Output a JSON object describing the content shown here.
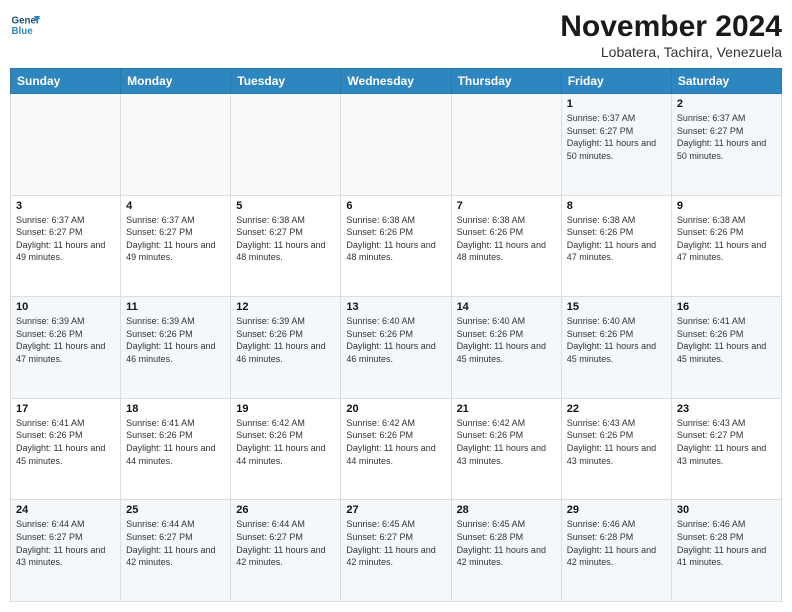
{
  "logo": {
    "line1": "General",
    "line2": "Blue"
  },
  "title": "November 2024",
  "subtitle": "Lobatera, Tachira, Venezuela",
  "weekdays": [
    "Sunday",
    "Monday",
    "Tuesday",
    "Wednesday",
    "Thursday",
    "Friday",
    "Saturday"
  ],
  "weeks": [
    [
      {
        "day": "",
        "info": ""
      },
      {
        "day": "",
        "info": ""
      },
      {
        "day": "",
        "info": ""
      },
      {
        "day": "",
        "info": ""
      },
      {
        "day": "",
        "info": ""
      },
      {
        "day": "1",
        "info": "Sunrise: 6:37 AM\nSunset: 6:27 PM\nDaylight: 11 hours and 50 minutes."
      },
      {
        "day": "2",
        "info": "Sunrise: 6:37 AM\nSunset: 6:27 PM\nDaylight: 11 hours and 50 minutes."
      }
    ],
    [
      {
        "day": "3",
        "info": "Sunrise: 6:37 AM\nSunset: 6:27 PM\nDaylight: 11 hours and 49 minutes."
      },
      {
        "day": "4",
        "info": "Sunrise: 6:37 AM\nSunset: 6:27 PM\nDaylight: 11 hours and 49 minutes."
      },
      {
        "day": "5",
        "info": "Sunrise: 6:38 AM\nSunset: 6:27 PM\nDaylight: 11 hours and 48 minutes."
      },
      {
        "day": "6",
        "info": "Sunrise: 6:38 AM\nSunset: 6:26 PM\nDaylight: 11 hours and 48 minutes."
      },
      {
        "day": "7",
        "info": "Sunrise: 6:38 AM\nSunset: 6:26 PM\nDaylight: 11 hours and 48 minutes."
      },
      {
        "day": "8",
        "info": "Sunrise: 6:38 AM\nSunset: 6:26 PM\nDaylight: 11 hours and 47 minutes."
      },
      {
        "day": "9",
        "info": "Sunrise: 6:38 AM\nSunset: 6:26 PM\nDaylight: 11 hours and 47 minutes."
      }
    ],
    [
      {
        "day": "10",
        "info": "Sunrise: 6:39 AM\nSunset: 6:26 PM\nDaylight: 11 hours and 47 minutes."
      },
      {
        "day": "11",
        "info": "Sunrise: 6:39 AM\nSunset: 6:26 PM\nDaylight: 11 hours and 46 minutes."
      },
      {
        "day": "12",
        "info": "Sunrise: 6:39 AM\nSunset: 6:26 PM\nDaylight: 11 hours and 46 minutes."
      },
      {
        "day": "13",
        "info": "Sunrise: 6:40 AM\nSunset: 6:26 PM\nDaylight: 11 hours and 46 minutes."
      },
      {
        "day": "14",
        "info": "Sunrise: 6:40 AM\nSunset: 6:26 PM\nDaylight: 11 hours and 45 minutes."
      },
      {
        "day": "15",
        "info": "Sunrise: 6:40 AM\nSunset: 6:26 PM\nDaylight: 11 hours and 45 minutes."
      },
      {
        "day": "16",
        "info": "Sunrise: 6:41 AM\nSunset: 6:26 PM\nDaylight: 11 hours and 45 minutes."
      }
    ],
    [
      {
        "day": "17",
        "info": "Sunrise: 6:41 AM\nSunset: 6:26 PM\nDaylight: 11 hours and 45 minutes."
      },
      {
        "day": "18",
        "info": "Sunrise: 6:41 AM\nSunset: 6:26 PM\nDaylight: 11 hours and 44 minutes."
      },
      {
        "day": "19",
        "info": "Sunrise: 6:42 AM\nSunset: 6:26 PM\nDaylight: 11 hours and 44 minutes."
      },
      {
        "day": "20",
        "info": "Sunrise: 6:42 AM\nSunset: 6:26 PM\nDaylight: 11 hours and 44 minutes."
      },
      {
        "day": "21",
        "info": "Sunrise: 6:42 AM\nSunset: 6:26 PM\nDaylight: 11 hours and 43 minutes."
      },
      {
        "day": "22",
        "info": "Sunrise: 6:43 AM\nSunset: 6:26 PM\nDaylight: 11 hours and 43 minutes."
      },
      {
        "day": "23",
        "info": "Sunrise: 6:43 AM\nSunset: 6:27 PM\nDaylight: 11 hours and 43 minutes."
      }
    ],
    [
      {
        "day": "24",
        "info": "Sunrise: 6:44 AM\nSunset: 6:27 PM\nDaylight: 11 hours and 43 minutes."
      },
      {
        "day": "25",
        "info": "Sunrise: 6:44 AM\nSunset: 6:27 PM\nDaylight: 11 hours and 42 minutes."
      },
      {
        "day": "26",
        "info": "Sunrise: 6:44 AM\nSunset: 6:27 PM\nDaylight: 11 hours and 42 minutes."
      },
      {
        "day": "27",
        "info": "Sunrise: 6:45 AM\nSunset: 6:27 PM\nDaylight: 11 hours and 42 minutes."
      },
      {
        "day": "28",
        "info": "Sunrise: 6:45 AM\nSunset: 6:28 PM\nDaylight: 11 hours and 42 minutes."
      },
      {
        "day": "29",
        "info": "Sunrise: 6:46 AM\nSunset: 6:28 PM\nDaylight: 11 hours and 42 minutes."
      },
      {
        "day": "30",
        "info": "Sunrise: 6:46 AM\nSunset: 6:28 PM\nDaylight: 11 hours and 41 minutes."
      }
    ]
  ]
}
